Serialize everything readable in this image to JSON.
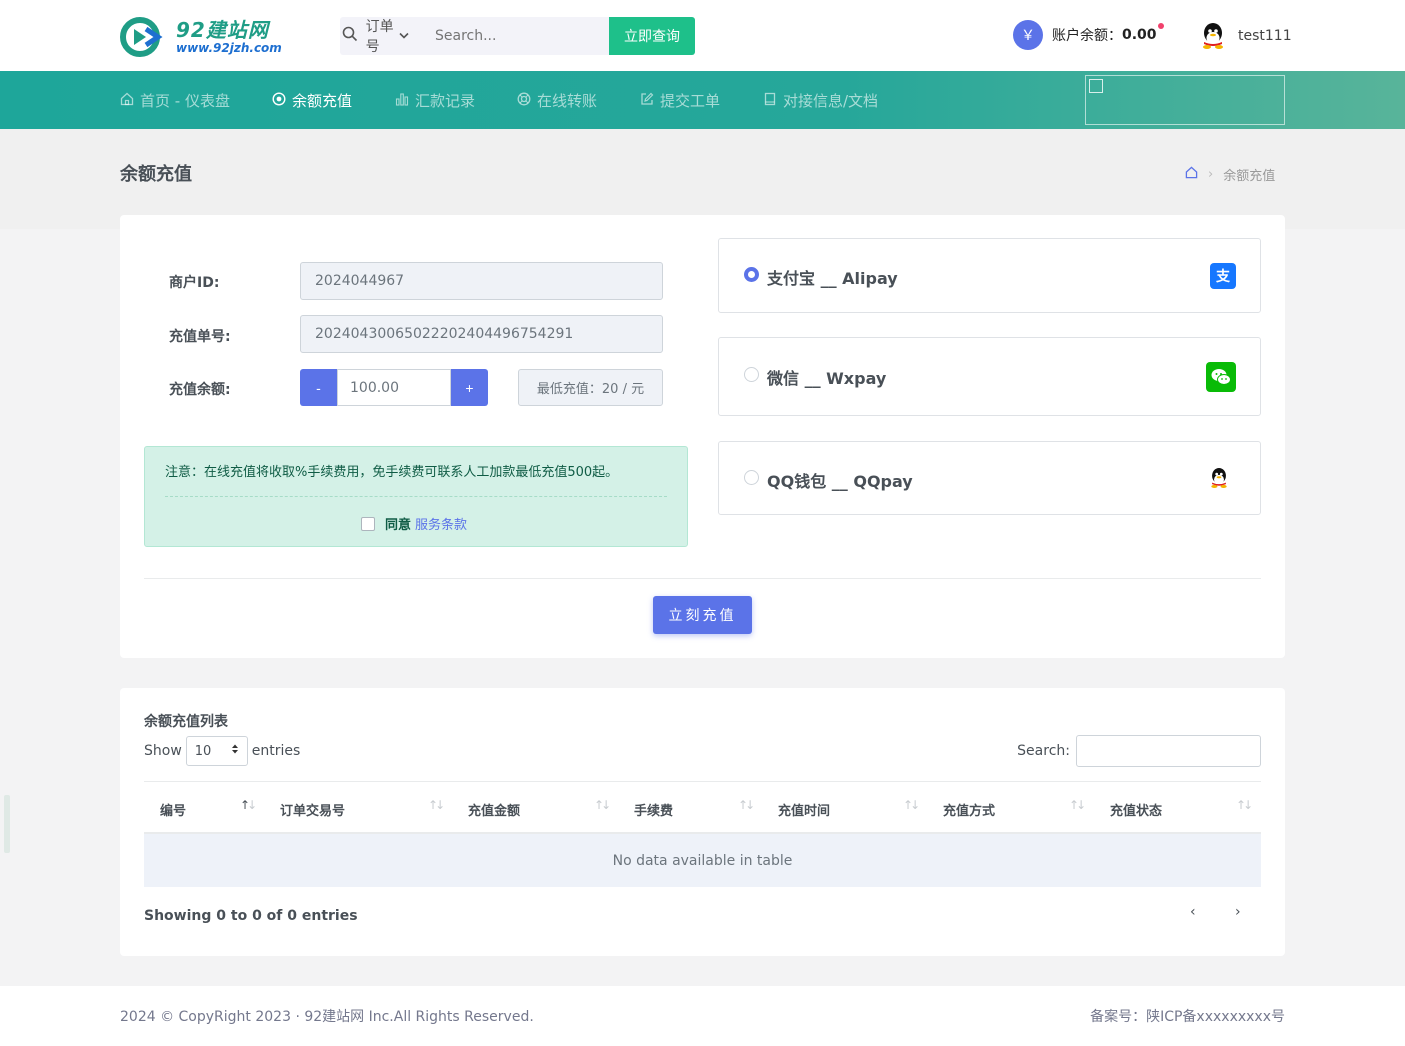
{
  "header": {
    "logo_text": "92建站网",
    "logo_sub": "www.92jzh.com",
    "search_type": "订单号",
    "search_placeholder": "Search...",
    "search_button": "立即查询",
    "balance_icon": "￥",
    "balance_label": "账户余额：",
    "balance_value": "0.00",
    "username": "test111"
  },
  "nav": {
    "items": [
      {
        "label": "首页 - 仪表盘",
        "icon": "home-icon"
      },
      {
        "label": "余额充值",
        "icon": "target-icon"
      },
      {
        "label": "汇款记录",
        "icon": "bar-chart-icon"
      },
      {
        "label": "在线转账",
        "icon": "lifebuoy-icon"
      },
      {
        "label": "提交工单",
        "icon": "edit-icon"
      },
      {
        "label": "对接信息/文档",
        "icon": "book-icon"
      }
    ]
  },
  "page": {
    "title": "余额充值",
    "breadcrumb_current": "余额充值"
  },
  "form": {
    "merchant_label": "商户ID:",
    "merchant_value": "2024044967",
    "order_label": "充值单号:",
    "order_value": "20240430065022202404496754291",
    "amount_label": "充值余额:",
    "minus": "-",
    "plus": "+",
    "amount_value": "100.00",
    "min_text": "最低充值：20 / 元",
    "notice": "注意：在线充值将收取%手续费用，免手续费可联系人工加款最低充值500起。",
    "agree": "同意",
    "terms": "服务条款",
    "submit": "立刻充值"
  },
  "payments": [
    {
      "label": "支付宝 __ Alipay",
      "selected": true,
      "icon": "alipay-icon",
      "color": "#1677ff"
    },
    {
      "label": "微信 __ Wxpay",
      "selected": false,
      "icon": "wechat-icon",
      "color": "#09bb07"
    },
    {
      "label": "QQ钱包 __ QQpay",
      "selected": false,
      "icon": "qq-icon",
      "color": "#222222"
    }
  ],
  "table": {
    "title": "余额充值列表",
    "show": "Show",
    "page_size": "10",
    "entries": "entries",
    "search_label": "Search:",
    "columns": [
      "编号",
      "订单交易号",
      "充值金额",
      "手续费",
      "充值时间",
      "充值方式",
      "充值状态"
    ],
    "empty": "No data available in table",
    "showing": "Showing 0 to 0 of 0 entries",
    "prev": "‹",
    "next": "›"
  },
  "footer": {
    "copyright": "2024 © CopyRight 2023 · 92建站网 Inc.All Rights Reserved.",
    "icp": "备案号：陕ICP备xxxxxxxxx号"
  },
  "colors": {
    "primary": "#5b73e8",
    "success": "#1ec08a",
    "nav_start": "#1ea69a",
    "nav_end": "#58b49a"
  }
}
